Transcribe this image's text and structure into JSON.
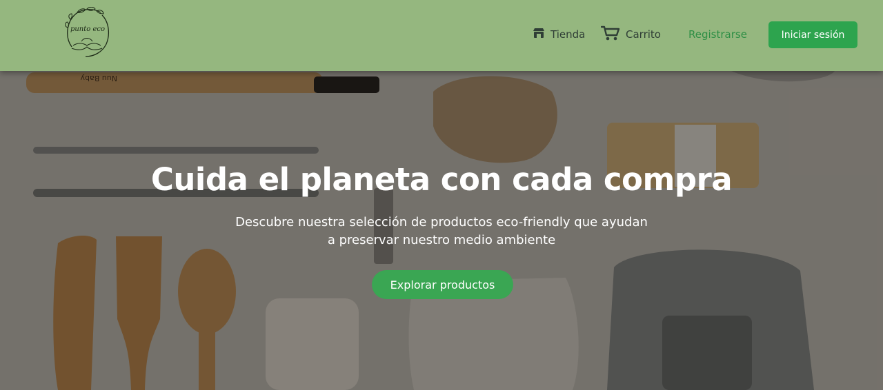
{
  "brand": {
    "logo_text": "punto eco",
    "logo_icon": "leaf-wreath-hands-logo"
  },
  "nav": {
    "tienda": {
      "label": "Tienda",
      "icon": "shop-icon"
    },
    "carrito": {
      "label": "Carrito",
      "icon": "cart-icon"
    },
    "registrarse": {
      "label": "Registrarse"
    },
    "login_button": "Iniciar sesión"
  },
  "hero": {
    "title": "Cuida el planeta con cada compra",
    "subtitle_line1": "Descubre nuestra selección de productos eco-friendly que ayudan",
    "subtitle_line2": "a preservar nuestro medio ambiente",
    "cta_label": "Explorar productos",
    "photo_stamp_text": "Nuu Baby"
  },
  "colors": {
    "header_bg": "#95b77f",
    "primary_green": "#2da44e",
    "registrarse_green": "#2e8f45",
    "nav_text": "#2f3e36"
  }
}
